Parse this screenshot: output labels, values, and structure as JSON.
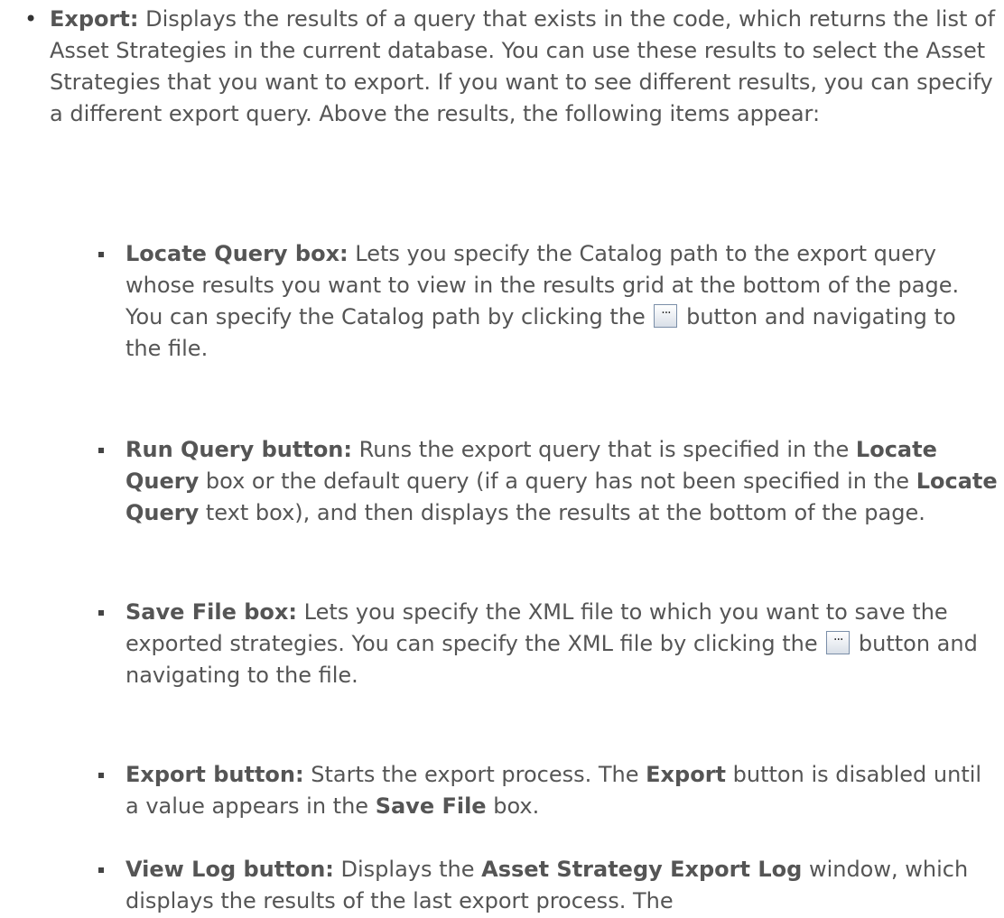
{
  "export": {
    "label": "Export:",
    "description": "Displays the results of a query that exists in the code, which returns the list of Asset Strategies in the current database. You can use these results to select the Asset Strategies that you want to export. If you want to see different results, you can specify a different export query. Above the results, the following items appear:"
  },
  "items": {
    "locate_query": {
      "label": "Locate Query box:",
      "text_a": "Lets you specify the Catalog path to the export query whose results you want to view in the results grid at the bottom of the page. You can specify the Catalog path by clicking the",
      "button_glyph": "···",
      "text_b": "button and navigating to the file."
    },
    "run_query": {
      "label": "Run Query button:",
      "text_a": "Runs the export query that is specified in the",
      "ref1": "Locate Query",
      "text_b": "box or the default query (if a query has not been specified in the",
      "ref2": "Locate Query",
      "text_c": "text box), and then displays the results at the bottom of the page."
    },
    "save_file": {
      "label": "Save File box:",
      "text_a": "Lets you specify the XML file to which you want to save the exported strategies. You can specify the XML file by clicking the",
      "button_glyph": "···",
      "text_b": "button and navigating to the file."
    },
    "export_button": {
      "label": "Export button:",
      "text_a": "Starts the export process. The",
      "ref1": "Export",
      "text_b": "button is disabled until a value appears in the",
      "ref2": "Save File",
      "text_c": "box."
    },
    "view_log": {
      "label": "View Log button:",
      "text_a": "Displays the",
      "ref1": "Asset Strategy Export Log",
      "text_b": "window, which displays the results of the last export process. The"
    }
  }
}
